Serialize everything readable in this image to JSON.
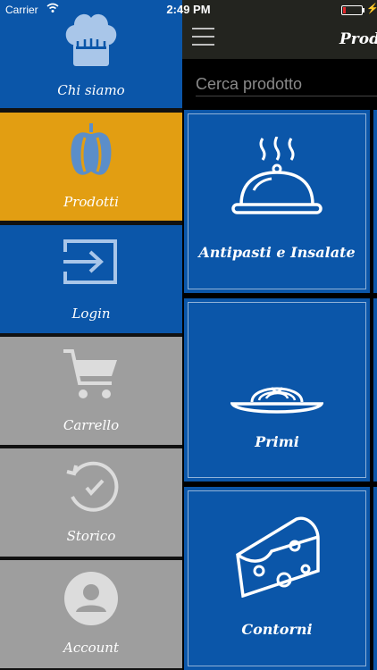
{
  "status_bar": {
    "carrier": "Carrier",
    "time": "2:49 PM",
    "charging_symbol": "⚡"
  },
  "menu": {
    "items": [
      {
        "label": "Chi siamo",
        "icon": "chef-hat-icon",
        "color": "#0b56a9"
      },
      {
        "label": "Prodotti",
        "icon": "pepper-icon",
        "color": "#e29e12",
        "selected": true
      },
      {
        "label": "Login",
        "icon": "login-icon",
        "color": "#0b56a9"
      },
      {
        "label": "Carrello",
        "icon": "cart-icon",
        "color": "#9e9e9e"
      },
      {
        "label": "Storico",
        "icon": "history-icon",
        "color": "#9e9e9e"
      },
      {
        "label": "Account",
        "icon": "account-icon",
        "color": "#9e9e9e"
      }
    ]
  },
  "navbar": {
    "title": "Prodotti",
    "menu_icon": "hamburger-icon"
  },
  "search": {
    "placeholder": "Cerca prodotto",
    "value": ""
  },
  "categories": [
    {
      "label": "Antipasti e Insalate",
      "icon": "cloche-icon"
    },
    {
      "label": "Primi",
      "icon": "pasta-plate-icon"
    },
    {
      "label": "Contorni",
      "icon": "cheese-icon"
    }
  ],
  "colors": {
    "accent_blue": "#0b56a9",
    "accent_orange": "#e29e12",
    "inactive_gray": "#9e9e9e",
    "navbar": "#23241f"
  }
}
